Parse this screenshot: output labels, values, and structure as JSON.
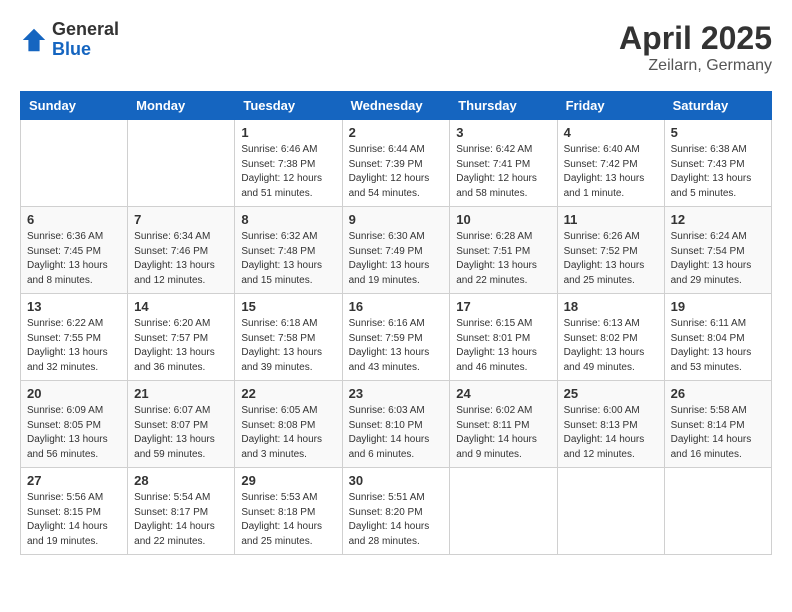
{
  "logo": {
    "general": "General",
    "blue": "Blue"
  },
  "title": {
    "month": "April 2025",
    "location": "Zeilarn, Germany"
  },
  "weekdays": [
    "Sunday",
    "Monday",
    "Tuesday",
    "Wednesday",
    "Thursday",
    "Friday",
    "Saturday"
  ],
  "weeks": [
    [
      {
        "day": "",
        "info": ""
      },
      {
        "day": "",
        "info": ""
      },
      {
        "day": "1",
        "info": "Sunrise: 6:46 AM\nSunset: 7:38 PM\nDaylight: 12 hours and 51 minutes."
      },
      {
        "day": "2",
        "info": "Sunrise: 6:44 AM\nSunset: 7:39 PM\nDaylight: 12 hours and 54 minutes."
      },
      {
        "day": "3",
        "info": "Sunrise: 6:42 AM\nSunset: 7:41 PM\nDaylight: 12 hours and 58 minutes."
      },
      {
        "day": "4",
        "info": "Sunrise: 6:40 AM\nSunset: 7:42 PM\nDaylight: 13 hours and 1 minute."
      },
      {
        "day": "5",
        "info": "Sunrise: 6:38 AM\nSunset: 7:43 PM\nDaylight: 13 hours and 5 minutes."
      }
    ],
    [
      {
        "day": "6",
        "info": "Sunrise: 6:36 AM\nSunset: 7:45 PM\nDaylight: 13 hours and 8 minutes."
      },
      {
        "day": "7",
        "info": "Sunrise: 6:34 AM\nSunset: 7:46 PM\nDaylight: 13 hours and 12 minutes."
      },
      {
        "day": "8",
        "info": "Sunrise: 6:32 AM\nSunset: 7:48 PM\nDaylight: 13 hours and 15 minutes."
      },
      {
        "day": "9",
        "info": "Sunrise: 6:30 AM\nSunset: 7:49 PM\nDaylight: 13 hours and 19 minutes."
      },
      {
        "day": "10",
        "info": "Sunrise: 6:28 AM\nSunset: 7:51 PM\nDaylight: 13 hours and 22 minutes."
      },
      {
        "day": "11",
        "info": "Sunrise: 6:26 AM\nSunset: 7:52 PM\nDaylight: 13 hours and 25 minutes."
      },
      {
        "day": "12",
        "info": "Sunrise: 6:24 AM\nSunset: 7:54 PM\nDaylight: 13 hours and 29 minutes."
      }
    ],
    [
      {
        "day": "13",
        "info": "Sunrise: 6:22 AM\nSunset: 7:55 PM\nDaylight: 13 hours and 32 minutes."
      },
      {
        "day": "14",
        "info": "Sunrise: 6:20 AM\nSunset: 7:57 PM\nDaylight: 13 hours and 36 minutes."
      },
      {
        "day": "15",
        "info": "Sunrise: 6:18 AM\nSunset: 7:58 PM\nDaylight: 13 hours and 39 minutes."
      },
      {
        "day": "16",
        "info": "Sunrise: 6:16 AM\nSunset: 7:59 PM\nDaylight: 13 hours and 43 minutes."
      },
      {
        "day": "17",
        "info": "Sunrise: 6:15 AM\nSunset: 8:01 PM\nDaylight: 13 hours and 46 minutes."
      },
      {
        "day": "18",
        "info": "Sunrise: 6:13 AM\nSunset: 8:02 PM\nDaylight: 13 hours and 49 minutes."
      },
      {
        "day": "19",
        "info": "Sunrise: 6:11 AM\nSunset: 8:04 PM\nDaylight: 13 hours and 53 minutes."
      }
    ],
    [
      {
        "day": "20",
        "info": "Sunrise: 6:09 AM\nSunset: 8:05 PM\nDaylight: 13 hours and 56 minutes."
      },
      {
        "day": "21",
        "info": "Sunrise: 6:07 AM\nSunset: 8:07 PM\nDaylight: 13 hours and 59 minutes."
      },
      {
        "day": "22",
        "info": "Sunrise: 6:05 AM\nSunset: 8:08 PM\nDaylight: 14 hours and 3 minutes."
      },
      {
        "day": "23",
        "info": "Sunrise: 6:03 AM\nSunset: 8:10 PM\nDaylight: 14 hours and 6 minutes."
      },
      {
        "day": "24",
        "info": "Sunrise: 6:02 AM\nSunset: 8:11 PM\nDaylight: 14 hours and 9 minutes."
      },
      {
        "day": "25",
        "info": "Sunrise: 6:00 AM\nSunset: 8:13 PM\nDaylight: 14 hours and 12 minutes."
      },
      {
        "day": "26",
        "info": "Sunrise: 5:58 AM\nSunset: 8:14 PM\nDaylight: 14 hours and 16 minutes."
      }
    ],
    [
      {
        "day": "27",
        "info": "Sunrise: 5:56 AM\nSunset: 8:15 PM\nDaylight: 14 hours and 19 minutes."
      },
      {
        "day": "28",
        "info": "Sunrise: 5:54 AM\nSunset: 8:17 PM\nDaylight: 14 hours and 22 minutes."
      },
      {
        "day": "29",
        "info": "Sunrise: 5:53 AM\nSunset: 8:18 PM\nDaylight: 14 hours and 25 minutes."
      },
      {
        "day": "30",
        "info": "Sunrise: 5:51 AM\nSunset: 8:20 PM\nDaylight: 14 hours and 28 minutes."
      },
      {
        "day": "",
        "info": ""
      },
      {
        "day": "",
        "info": ""
      },
      {
        "day": "",
        "info": ""
      }
    ]
  ]
}
